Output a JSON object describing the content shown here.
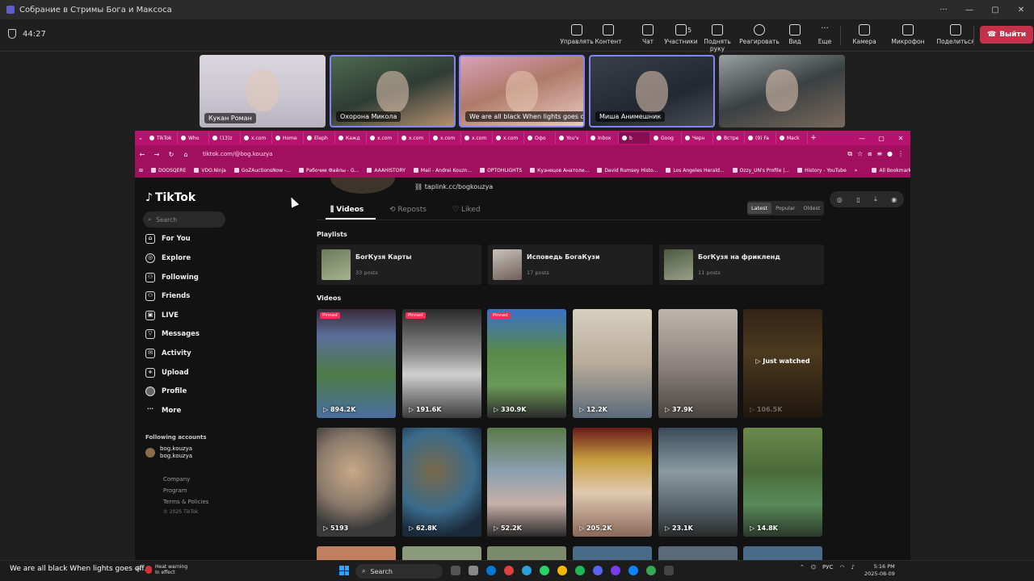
{
  "window": {
    "title": "Собрание в Стримы Бога и Максоса",
    "more": "···"
  },
  "meeting": {
    "timer": "44:27",
    "tools": [
      {
        "label": "Управлять",
        "icon": "manage-icon"
      },
      {
        "label": "Контент",
        "icon": "share-content-icon"
      },
      {
        "label": "Чат",
        "icon": "chat-icon"
      },
      {
        "label": "Участники",
        "icon": "participants-icon",
        "count": "5"
      },
      {
        "label": "Поднять руку",
        "icon": "raise-hand-icon"
      },
      {
        "label": "Реагировать",
        "icon": "react-icon"
      },
      {
        "label": "Вид",
        "icon": "view-icon"
      },
      {
        "label": "Еще",
        "icon": "more-icon"
      },
      {
        "label": "Камера",
        "icon": "camera-icon"
      },
      {
        "label": "Микрофон",
        "icon": "microphone-icon"
      },
      {
        "label": "Поделиться",
        "icon": "share-icon"
      }
    ],
    "leave_label": "Выйти",
    "participants": [
      {
        "name": "Кукан Роман",
        "bg": "linear-gradient(180deg,#d9d6df 0%,#c9c6d0 60%,#b8b2bd 100%)"
      },
      {
        "name": "Охорона Микола",
        "bg": "linear-gradient(160deg,#4d6b4e 0%,#2f3c36 50%,#b49070 100%)"
      },
      {
        "name": "We are all black When lights goes o...",
        "bg": "linear-gradient(160deg,#d9a0b8 0%,#b07a6a 45%,#e8c9c0 100%)"
      },
      {
        "name": "Миша Анимешник",
        "bg": "linear-gradient(160deg,#3a3f4a 0%,#222832 60%,#4b4e55 100%)"
      },
      {
        "name": "",
        "bg": "linear-gradient(160deg,#9aa0a2 0%,#3a4042 50%,#7a6a5e 100%)"
      }
    ]
  },
  "browser": {
    "tabs": [
      "TikTok",
      "Who",
      "(13)z",
      "x.com",
      "Home",
      "Eleph",
      "Кажд",
      "x.com",
      "x.com",
      "x.com",
      "x.com",
      "x.com",
      "Офо",
      "You'v",
      "Inbox",
      "b",
      "Goog",
      "Черн",
      "Встре",
      "(9) Fa",
      "Mack"
    ],
    "active_tab_index": 15,
    "url": "tiktok.com/@bog.kouzya",
    "bookmarks": [
      "DOOSQERE",
      "VDO.Ninja",
      "GoZAuctionsNow -...",
      "Рабочие Файлы - G...",
      "AAAHISTORY",
      "Mail - Andrei Kouzn...",
      "OPTOHLIGHTS",
      "Кузнецов Анатоли...",
      "David Rumsey Histo...",
      "Los Angeles Herald...",
      "Ozzy_UN's Profile |...",
      "History - YouTube",
      "»",
      "All Bookmarks"
    ]
  },
  "tiktok": {
    "logo": "TikTok",
    "search_placeholder": "Search",
    "nav": [
      {
        "label": "For You",
        "icon": "home-icon"
      },
      {
        "label": "Explore",
        "icon": "compass-icon"
      },
      {
        "label": "Following",
        "icon": "following-icon"
      },
      {
        "label": "Friends",
        "icon": "friends-icon"
      },
      {
        "label": "LIVE",
        "icon": "live-icon"
      },
      {
        "label": "Messages",
        "icon": "messages-icon"
      },
      {
        "label": "Activity",
        "icon": "activity-icon"
      },
      {
        "label": "Upload",
        "icon": "upload-icon"
      },
      {
        "label": "Profile",
        "icon": "profile-icon"
      },
      {
        "label": "More",
        "icon": "more-dots-icon"
      }
    ],
    "following_title": "Following accounts",
    "following_account": {
      "name": "bog.kouzya",
      "handle": "bog.kouzya"
    },
    "footer": [
      "Company",
      "Program",
      "Terms & Policies",
      "© 2025 TikTok"
    ],
    "profile_link": "taplink.cc/bogkouzya",
    "tabs": [
      "Videos",
      "Reposts",
      "Liked"
    ],
    "sort": [
      "Latest",
      "Popular",
      "Oldest"
    ],
    "playlists_title": "Playlists",
    "playlists": [
      {
        "title": "БогКузя Карты",
        "count": "33 posts",
        "bg": "linear-gradient(160deg,#6b7b5a,#a7b28f)"
      },
      {
        "title": "Исповедь БогаКузи",
        "count": "17 posts",
        "bg": "linear-gradient(160deg,#c9c3bd,#6e5f57)"
      },
      {
        "title": "БогКузя на фрикленд",
        "count": "11 posts",
        "bg": "linear-gradient(160deg,#4c5a3e,#9aa08a)"
      }
    ],
    "videos_title": "Videos",
    "pinned_label": "Pinned",
    "watched_label": "▷ Just watched",
    "videos": [
      {
        "views": "894.2K",
        "pinned": true,
        "bg": "linear-gradient(180deg,#3a2a3a 0%,#5b6f9a 25%,#4e7a46 60%,#4a6fa0 100%)"
      },
      {
        "views": "191.6K",
        "pinned": true,
        "bg": "linear-gradient(180deg,#2a2a2a 0%,#8a8a8a 40%,#d0d0d0 60%,#3c3c3c 100%)"
      },
      {
        "views": "330.9K",
        "pinned": true,
        "bg": "linear-gradient(180deg,#3a70c8 0%,#5a8a4a 40%,#6a9a58 70%,#2a2a2a 100%)"
      },
      {
        "views": "12.2K",
        "pinned": false,
        "bg": "linear-gradient(180deg,#d8cfc0 0%,#b8ab98 50%,#5a6a7a 100%)"
      },
      {
        "views": "37.9K",
        "pinned": false,
        "bg": "linear-gradient(180deg,#bdb5ac 0%,#8e8580 50%,#4a4440 100%)"
      },
      {
        "views": "106.5K",
        "pinned": false,
        "watched": true,
        "bg": "linear-gradient(180deg,#5a4028 0%,#8a6a3a 40%,#3a2a1a 100%)"
      },
      {
        "views": "5193",
        "pinned": false,
        "bg": "radial-gradient(circle at 45% 40%,#c9a888 0%,#8a7a6a 45%,#3a3a3a 75%)"
      },
      {
        "views": "62.8K",
        "pinned": false,
        "bg": "radial-gradient(circle at 40% 40%,#7a6a4a 0%,#3a6a8a 50%,#1a2a3a 80%)"
      },
      {
        "views": "52.2K",
        "pinned": false,
        "bg": "linear-gradient(180deg,#5a7a4a 0%,#8aa0b0 40%,#c8b0a8 70%,#2a2a2a 100%)"
      },
      {
        "views": "205.2K",
        "pinned": false,
        "bg": "linear-gradient(180deg,#6a1a1a 0%,#c8a040 30%,#e0c8b0 60%,#8a6a5a 100%)"
      },
      {
        "views": "23.1K",
        "pinned": false,
        "bg": "linear-gradient(180deg,#3a4a5a 0%,#8a9aa0 40%,#5a6a70 70%,#2a2a2a 100%)"
      },
      {
        "views": "14.8K",
        "pinned": false,
        "bg": "linear-gradient(180deg,#6a8a4a 0%,#4a6a3a 40%,#5a8a5a 70%,#2a3a2a 100%)"
      }
    ]
  },
  "taskbar": {
    "caption": "We are all black When lights goes off.",
    "heat_line1": "Heat warning",
    "heat_line2": "In effect",
    "search": "Search",
    "lang": "РУС",
    "time": "5:16 PM",
    "date": "2025-08-09"
  }
}
